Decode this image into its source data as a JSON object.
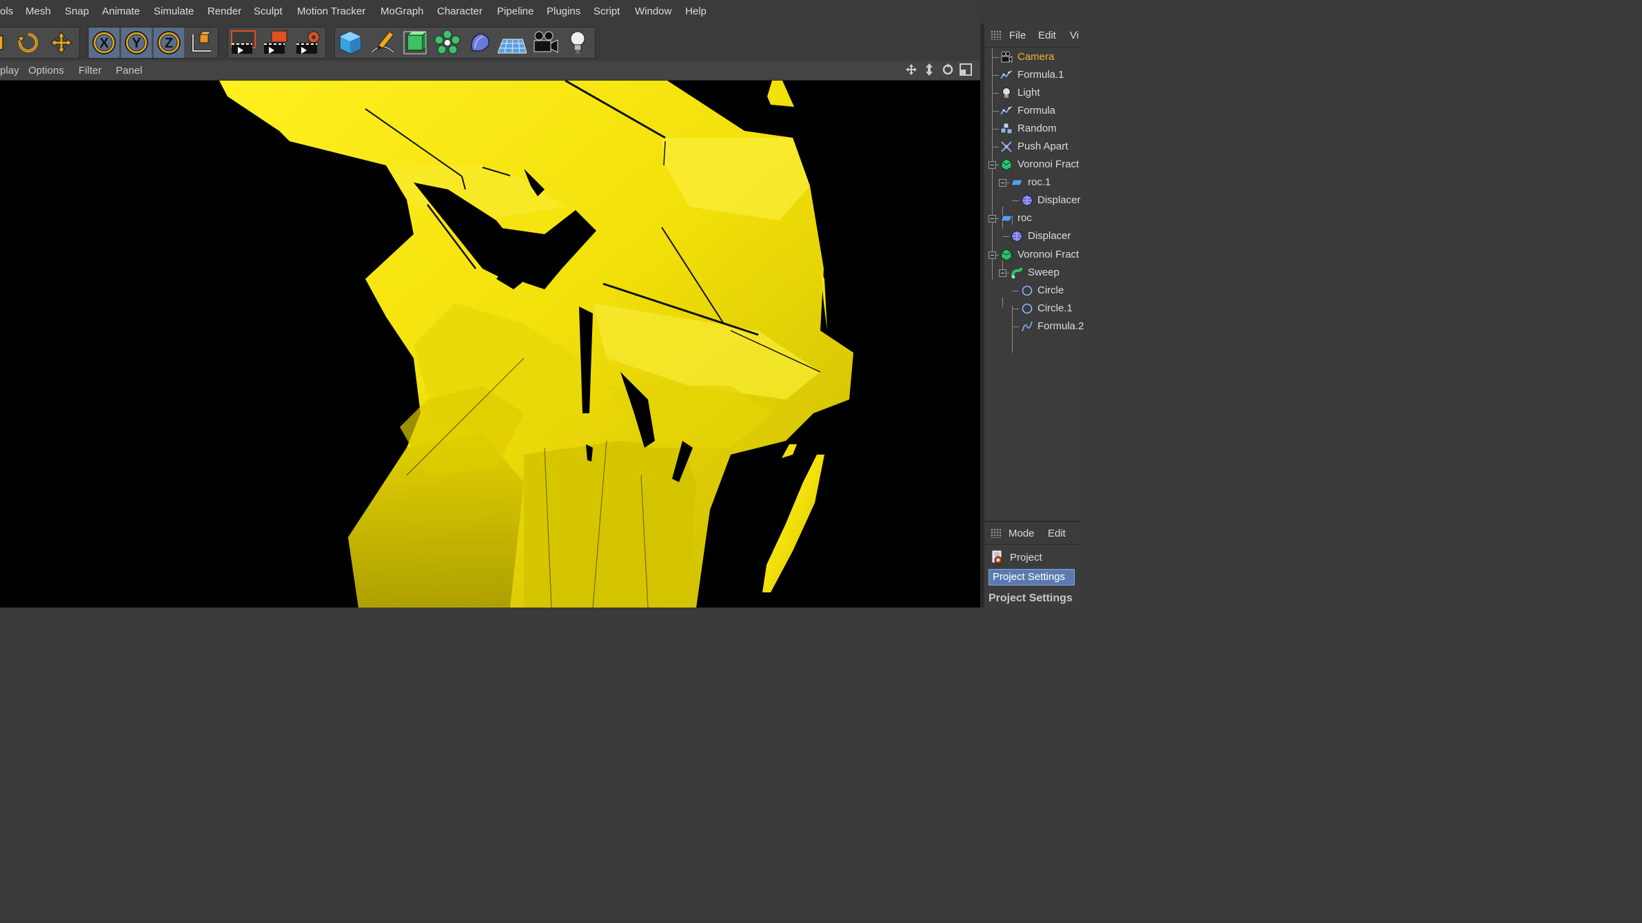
{
  "menubar": {
    "items": [
      "ols",
      "Mesh",
      "Snap",
      "Animate",
      "Simulate",
      "Render",
      "Sculpt",
      "Motion Tracker",
      "MoGraph",
      "Character",
      "Pipeline",
      "Plugins",
      "Script",
      "Window",
      "Help"
    ]
  },
  "toolbar": {
    "icons": [
      "scale-tool-icon",
      "rotate-tool-icon",
      "move-tool-icon",
      "x-axis-lock-icon",
      "y-axis-lock-icon",
      "z-axis-lock-icon",
      "coordinate-system-icon",
      "render-view-icon",
      "render-picture-viewer-icon",
      "render-settings-icon",
      "cube-icon",
      "pen-icon",
      "subdivision-icon",
      "cloner-icon",
      "deformer-icon",
      "floor-icon",
      "camera-icon",
      "light-icon"
    ]
  },
  "viewport_menu": {
    "items": [
      "play",
      "Options",
      "Filter",
      "Panel"
    ]
  },
  "object_manager": {
    "header": [
      "File",
      "Edit",
      "Vi"
    ],
    "objects": [
      {
        "name": "Camera",
        "icon": "camera-icon",
        "depth": 0,
        "selected": true
      },
      {
        "name": "Formula.1",
        "icon": "formula-spline-icon",
        "depth": 0
      },
      {
        "name": "Light",
        "icon": "light-icon",
        "depth": 0
      },
      {
        "name": "Formula",
        "icon": "formula-spline-icon",
        "depth": 0
      },
      {
        "name": "Random",
        "icon": "random-effector-icon",
        "depth": 0
      },
      {
        "name": "Push Apart",
        "icon": "push-apart-effector-icon",
        "depth": 0
      },
      {
        "name": "Voronoi Fract",
        "icon": "voronoi-fracture-icon",
        "depth": 0,
        "expanded": true
      },
      {
        "name": "roc.1",
        "icon": "plane-icon",
        "depth": 1,
        "expanded": true
      },
      {
        "name": "Displacer",
        "icon": "displacer-icon",
        "depth": 2
      },
      {
        "name": "roc",
        "icon": "plane-icon",
        "depth": 0,
        "expanded": true
      },
      {
        "name": "Displacer",
        "icon": "displacer-icon",
        "depth": 1
      },
      {
        "name": "Voronoi Fract",
        "icon": "voronoi-fracture-icon",
        "depth": 0,
        "expanded": true
      },
      {
        "name": "Sweep",
        "icon": "sweep-icon",
        "depth": 1,
        "expanded": true
      },
      {
        "name": "Circle",
        "icon": "circle-spline-icon",
        "depth": 2
      },
      {
        "name": "Circle.1",
        "icon": "circle-spline-icon",
        "depth": 2
      },
      {
        "name": "Formula.2",
        "icon": "formula-spline-icon",
        "depth": 2
      }
    ]
  },
  "attribute_manager": {
    "header": [
      "Mode",
      "Edit"
    ],
    "project_label": "Project",
    "tab": "Project Settings",
    "section": "Project Settings"
  },
  "colors": {
    "selected_text": "#f0b43c",
    "object_yellow": "#f2e20a",
    "accent_blue": "#5b7bb0"
  }
}
